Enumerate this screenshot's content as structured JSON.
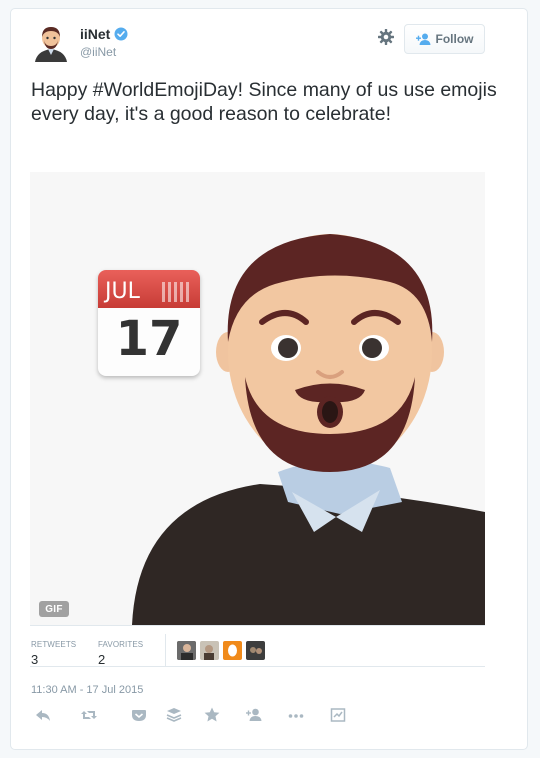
{
  "user": {
    "display_name": "iiNet",
    "handle": "@iiNet",
    "avatar_icon": "avatar-man-emoji",
    "verified_icon": "verified-badge-icon"
  },
  "header": {
    "follow_label": "Follow",
    "gear_icon": "gear-icon"
  },
  "tweet": {
    "text": "Happy #WorldEmojiDay! Since many of us use emojis every day, it's a good reason to celebrate!",
    "hashtag": "#WorldEmojiDay"
  },
  "media": {
    "badge": "GIF",
    "calendar_month": "JUL",
    "calendar_day": "17"
  },
  "stats": {
    "retweets_label": "RETWEETS",
    "retweets_value": "3",
    "favorites_label": "FAVORITES",
    "favorites_value": "2"
  },
  "timestamp": "11:30 AM - 17 Jul 2015",
  "actions": [
    "reply-icon",
    "retweet-icon",
    "pocket-icon",
    "buffer-icon",
    "favorite-icon",
    "follow-icon",
    "more-icon",
    "analytics-icon"
  ],
  "colors": {
    "brand_blue": "#55acee",
    "text": "#292f33",
    "muted": "#8899a6",
    "border": "#e1e8ed",
    "calendar_red": "#d9534f"
  }
}
